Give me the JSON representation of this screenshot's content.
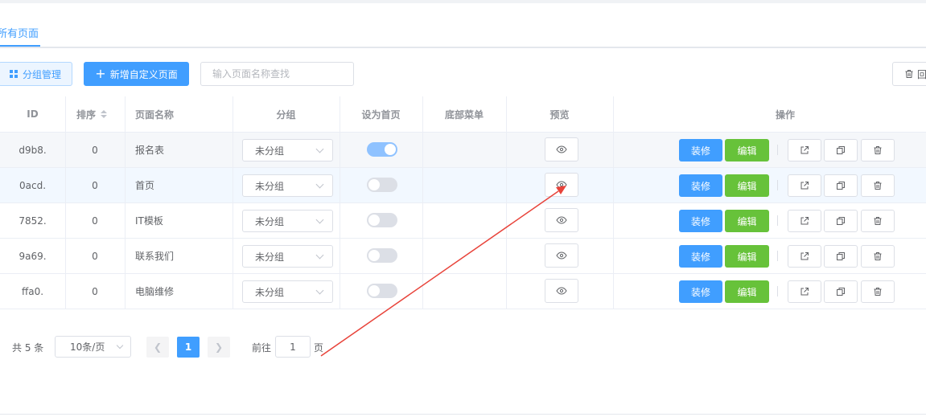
{
  "tabs": {
    "active_label": "所有页面"
  },
  "toolbar": {
    "group_button": "分组管理",
    "new_button": "新增自定义页面",
    "search_placeholder": "输入页面名称查找",
    "recycle_button": "回"
  },
  "table": {
    "columns": {
      "id": "ID",
      "sort": "排序",
      "name": "页面名称",
      "group": "分组",
      "home": "设为首页",
      "bottom_menu": "底部菜单",
      "preview": "预览",
      "ops": "操作"
    },
    "actions": {
      "decorate": "装修",
      "edit": "编辑"
    },
    "rows": [
      {
        "id": "d9b8.",
        "sort": "0",
        "name": "报名表",
        "group": "未分组",
        "home": true
      },
      {
        "id": "0acd.",
        "sort": "0",
        "name": "首页",
        "group": "未分组",
        "home": false
      },
      {
        "id": "7852.",
        "sort": "0",
        "name": "IT模板",
        "group": "未分组",
        "home": false
      },
      {
        "id": "9a69.",
        "sort": "0",
        "name": "联系我们",
        "group": "未分组",
        "home": false
      },
      {
        "id": "ffa0.",
        "sort": "0",
        "name": "电脑维修",
        "group": "未分组",
        "home": false
      }
    ]
  },
  "pagination": {
    "total": "共 5 条",
    "page_size": "10条/页",
    "current_page": "1",
    "goto_prefix": "前往",
    "goto_value": "1",
    "goto_suffix": "页"
  },
  "colors": {
    "primary": "#409eff",
    "success": "#67c23a",
    "annotation_arrow": "#e8433a"
  }
}
